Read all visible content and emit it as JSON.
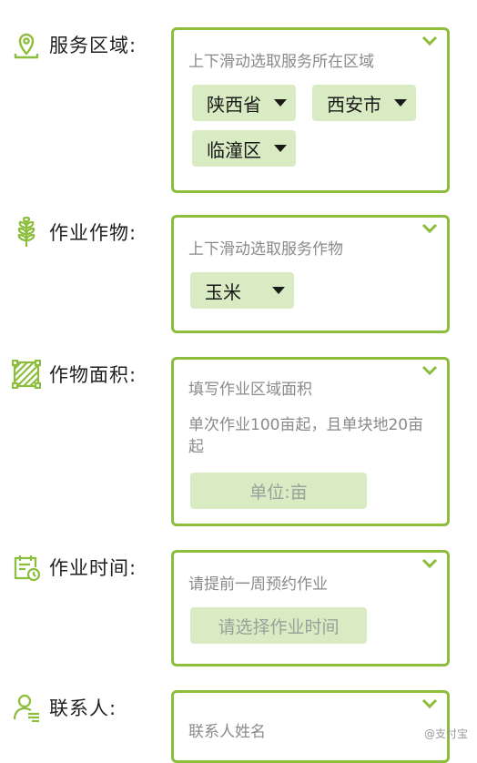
{
  "colors": {
    "accent": "#8cbd3c",
    "chip_bg": "#d8ebc2",
    "hint": "#8a8a8a"
  },
  "service_area": {
    "label": "服务区域:",
    "icon": "map-pin-icon",
    "hint": "上下滑动选取服务所在区域",
    "province": "陕西省",
    "city": "西安市",
    "district": "临潼区"
  },
  "crop": {
    "label": "作业作物:",
    "icon": "wheat-icon",
    "hint": "上下滑动选取服务作物",
    "selected": "玉米"
  },
  "area": {
    "label": "作物面积:",
    "icon": "area-icon",
    "hint": "填写作业区域面积",
    "note": "单次作业100亩起，且单块地20亩起",
    "unit_button": "单位:亩"
  },
  "time": {
    "label": "作业时间:",
    "icon": "calendar-clock-icon",
    "hint": "请提前一周预约作业",
    "select_button": "请选择作业时间"
  },
  "contact": {
    "label": "联系人:",
    "icon": "person-icon",
    "hint": "联系人姓名"
  },
  "watermark": "@支付宝"
}
